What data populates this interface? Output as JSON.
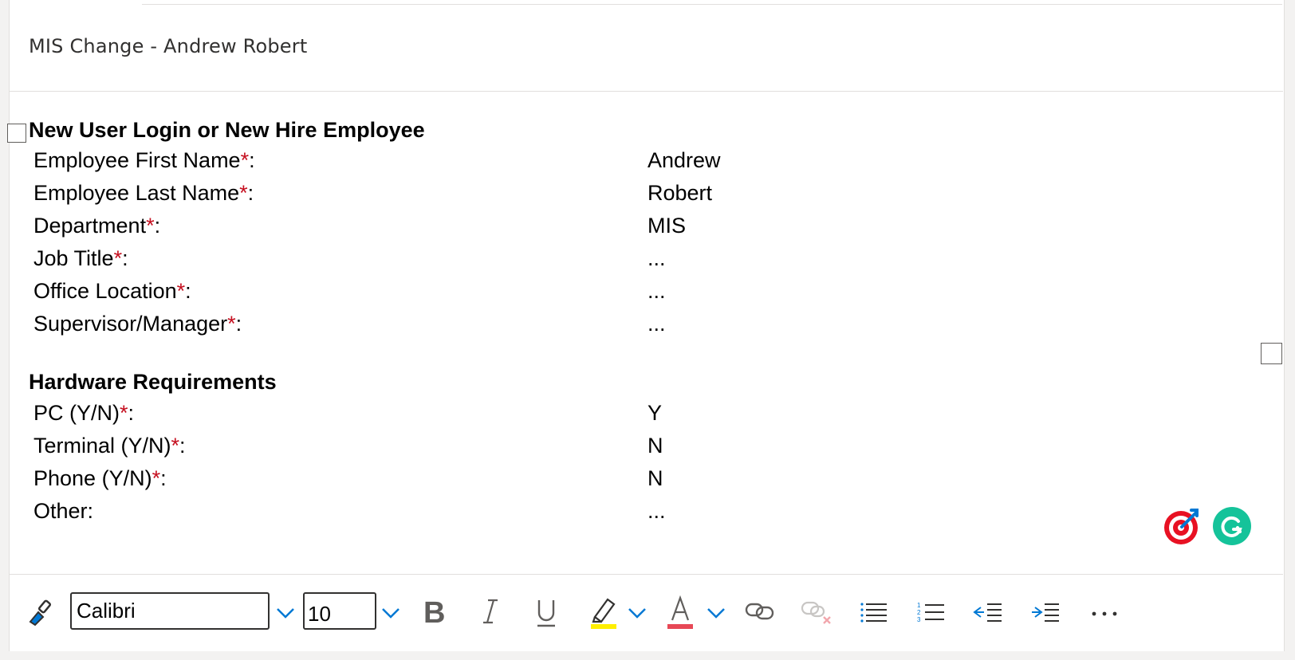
{
  "subject": "MIS Change - Andrew Robert",
  "sections": [
    {
      "heading": "New User Login or New Hire Employee",
      "rows": [
        {
          "label": "Employee First Name",
          "required": "*",
          "suffix": ":",
          "value": "Andrew"
        },
        {
          "label": "Employee Last Name",
          "required": "*",
          "suffix": ":",
          "value": "Robert"
        },
        {
          "label": "Department",
          "required": "*",
          "suffix": ":",
          "value": "MIS"
        },
        {
          "label": "Job Title",
          "required": "*",
          "suffix": ":",
          "value": "..."
        },
        {
          "label": "Office Location",
          "required": "*",
          "suffix": ":",
          "value": "..."
        },
        {
          "label": "Supervisor/Manager",
          "required": "*",
          "suffix": ":",
          "value": "..."
        }
      ]
    },
    {
      "heading": "Hardware Requirements",
      "rows": [
        {
          "label": "PC (Y/N)",
          "required": "*",
          "suffix": ":",
          "value": "Y"
        },
        {
          "label": "Terminal (Y/N)",
          "required": "*",
          "suffix": ":",
          "value": "N"
        },
        {
          "label": "Phone (Y/N)",
          "required": "*",
          "suffix": ":",
          "value": "N"
        },
        {
          "label": "Other:",
          "required": "",
          "suffix": "",
          "value": "..."
        }
      ]
    }
  ],
  "toolbar": {
    "font_name": "Calibri",
    "font_size": "10",
    "icons": [
      "format-painter-icon",
      "bold-icon",
      "italic-icon",
      "underline-icon",
      "highlight-icon",
      "font-color-icon",
      "link-icon",
      "unlink-icon",
      "bullets-icon",
      "numbering-icon",
      "decrease-indent-icon",
      "increase-indent-icon",
      "more-options-icon"
    ],
    "highlight_color": "#ffef00",
    "font_color": "#e74856"
  },
  "colors": {
    "required_marker": "#c50f1f",
    "grammarly": "#15c39a",
    "accent_blue": "#0078d4"
  }
}
